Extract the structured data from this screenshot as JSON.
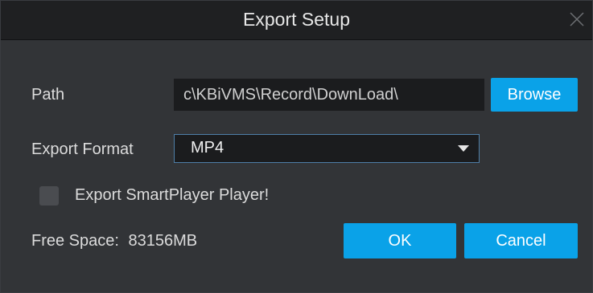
{
  "dialog": {
    "title": "Export Setup",
    "close_icon": "close-icon"
  },
  "path": {
    "label": "Path",
    "value": "c\\KBiVMS\\Record\\DownLoad\\",
    "browse_label": "Browse"
  },
  "format": {
    "label": "Export Format",
    "selected": "MP4",
    "arrow_icon": "dropdown-arrow-icon"
  },
  "smartplayer": {
    "label": "Export SmartPlayer Player!",
    "checked": false
  },
  "free_space": {
    "label": "Free Space:",
    "value": "83156MB"
  },
  "buttons": {
    "ok_label": "OK",
    "cancel_label": "Cancel"
  },
  "colors": {
    "accent": "#0aa2e8",
    "background": "#323437",
    "titlebar": "#1f2022",
    "field": "#1b1c1e"
  }
}
